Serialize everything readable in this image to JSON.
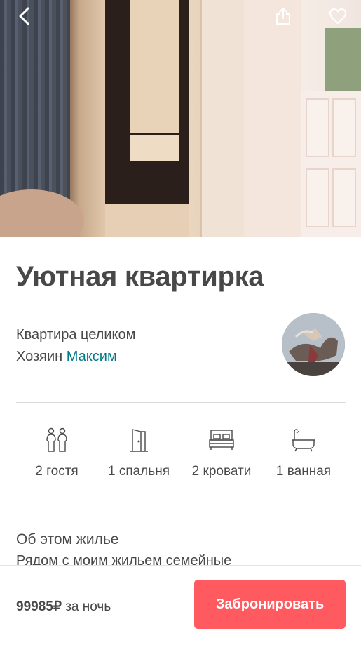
{
  "listing": {
    "title": "Уютная квартирка",
    "type": "Квартира целиком",
    "host_prefix": "Хозяин",
    "host_name": "Максим"
  },
  "amenities": [
    {
      "icon": "guests-icon",
      "label": "2 гостя"
    },
    {
      "icon": "door-icon",
      "label": "1 спальня"
    },
    {
      "icon": "bed-icon",
      "label": "2 кровати"
    },
    {
      "icon": "bathtub-icon",
      "label": "1 ванная"
    }
  ],
  "about": {
    "title": "Об этом жилье",
    "text": "Рядом с моим жильем семейные"
  },
  "footer": {
    "price": "99985₽",
    "per_night": "за ночь",
    "book_label": "Забронировать"
  },
  "colors": {
    "accent": "#ff5a5f",
    "link": "#007a87",
    "text": "#484848"
  }
}
